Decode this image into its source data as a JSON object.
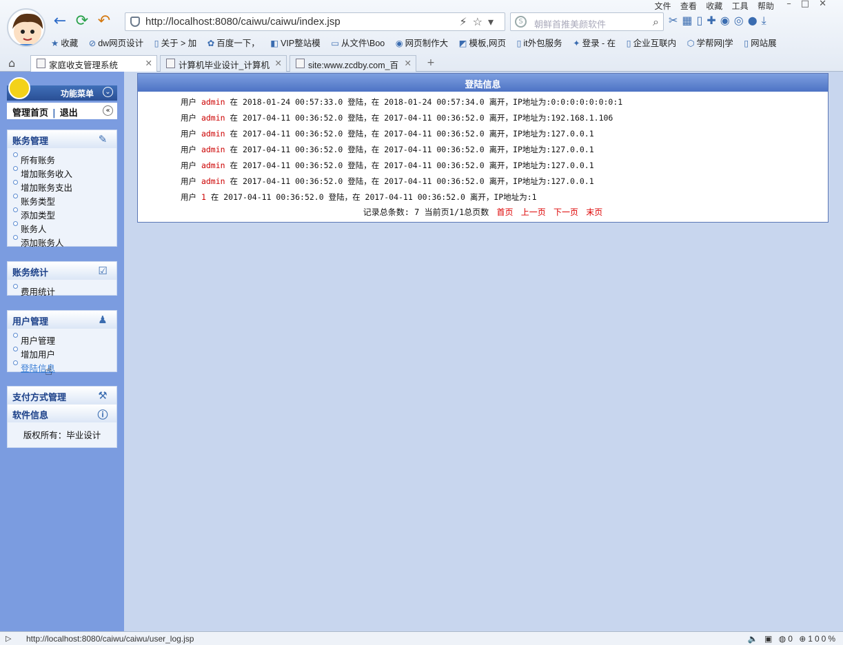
{
  "browser": {
    "menu": [
      "文件",
      "查看",
      "收藏",
      "工具",
      "帮助"
    ],
    "address": "http://localhost:8080/caiwu/caiwu/index.jsp",
    "search_placeholder": "朝鲜首推美颜软件",
    "favorites": [
      "收藏",
      "dw网页设计",
      "关于 > 加",
      "百度一下，",
      "VIP整站模",
      "从文件\\Boo",
      "网页制作大",
      "模板,网页",
      "it外包服务",
      "登录 - 在",
      "企业互联内",
      "学帮网|学",
      "网站展"
    ],
    "tabs": [
      {
        "label": "家庭收支管理系统",
        "active": true
      },
      {
        "label": "计算机毕业设计_计算机",
        "active": false
      },
      {
        "label": "site:www.zcdby.com_百",
        "active": false
      }
    ],
    "new_tab": "+"
  },
  "sidebar": {
    "menu_title": "功能菜单",
    "home_link": "管理首页",
    "logout_link": "退出",
    "sections": [
      {
        "title": "账务管理",
        "icon": "account-icon",
        "items": [
          "所有账务",
          "增加账务收入",
          "增加账务支出",
          "账务类型",
          "添加类型",
          "账务人",
          "添加账务人"
        ]
      },
      {
        "title": "账务统计",
        "icon": "stats-icon",
        "items": [
          "费用统计"
        ]
      },
      {
        "title": "用户管理",
        "icon": "user-icon",
        "items": [
          "用户管理",
          "增加用户",
          "登陆信息"
        ]
      }
    ],
    "payment_title": "支付方式管理",
    "software_title": "软件信息",
    "copyright": "版权所有：毕业设计"
  },
  "main": {
    "title": "登陆信息",
    "logs": [
      {
        "user": "admin",
        "login": "2018-01-24 00:57:33.0",
        "logout": "2018-01-24 00:57:34.0",
        "ip": "0:0:0:0:0:0:0:1"
      },
      {
        "user": "admin",
        "login": "2017-04-11 00:36:52.0",
        "logout": "2017-04-11 00:36:52.0",
        "ip": "192.168.1.106"
      },
      {
        "user": "admin",
        "login": "2017-04-11 00:36:52.0",
        "logout": "2017-04-11 00:36:52.0",
        "ip": "127.0.0.1"
      },
      {
        "user": "admin",
        "login": "2017-04-11 00:36:52.0",
        "logout": "2017-04-11 00:36:52.0",
        "ip": "127.0.0.1"
      },
      {
        "user": "admin",
        "login": "2017-04-11 00:36:52.0",
        "logout": "2017-04-11 00:36:52.0",
        "ip": "127.0.0.1"
      },
      {
        "user": "admin",
        "login": "2017-04-11 00:36:52.0",
        "logout": "2017-04-11 00:36:52.0",
        "ip": "127.0.0.1"
      },
      {
        "user": "1",
        "login": "2017-04-11 00:36:52.0",
        "logout": "2017-04-11 00:36:52.0",
        "ip": "1"
      }
    ],
    "log_words": {
      "user": "用户",
      "at": "在",
      "login": "登陆，在",
      "logout": "离开，IP地址为:"
    },
    "pager": {
      "summary": "记录总条数: 7 当前页1/1总页数",
      "first": "首页",
      "prev": "上一页",
      "next": "下一页",
      "last": "末页"
    }
  },
  "status": {
    "url": "http://localhost:8080/caiwu/caiwu/user_log.jsp",
    "count": "0",
    "zoom": "100%"
  }
}
